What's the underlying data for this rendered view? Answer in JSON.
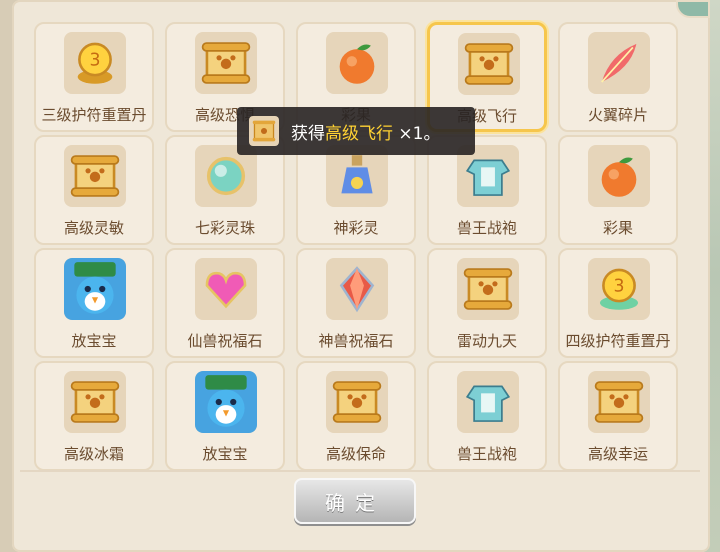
{
  "items": [
    {
      "name": "三级护符重置丹",
      "icon": "talisman-gold-icon"
    },
    {
      "name": "高级恐惧",
      "icon": "scroll-icon"
    },
    {
      "name": "彩果",
      "icon": "fruit-icon"
    },
    {
      "name": "高级飞行",
      "icon": "scroll-icon",
      "selected": true
    },
    {
      "name": "火翼碎片",
      "icon": "feather-icon"
    },
    {
      "name": "高级灵敏",
      "icon": "scroll-icon"
    },
    {
      "name": "七彩灵珠",
      "icon": "orb-icon"
    },
    {
      "name": "神彩灵",
      "icon": "potion-icon"
    },
    {
      "name": "兽王战袍",
      "icon": "armor-icon"
    },
    {
      "name": "彩果",
      "icon": "fruit-icon"
    },
    {
      "name": "放宝宝",
      "icon": "penguin-icon"
    },
    {
      "name": "仙兽祝福石",
      "icon": "heart-gem-icon"
    },
    {
      "name": "神兽祝福石",
      "icon": "crystal-icon"
    },
    {
      "name": "雷动九天",
      "icon": "scroll-icon"
    },
    {
      "name": "四级护符重置丹",
      "icon": "talisman-jade-icon"
    },
    {
      "name": "高级冰霜",
      "icon": "scroll-icon"
    },
    {
      "name": "放宝宝",
      "icon": "penguin-icon"
    },
    {
      "name": "高级保命",
      "icon": "scroll-icon"
    },
    {
      "name": "兽王战袍",
      "icon": "armor-icon"
    },
    {
      "name": "高级幸运",
      "icon": "scroll-icon"
    }
  ],
  "toast": {
    "prefix": "获得",
    "item": "高级飞行",
    "suffix": "×1。",
    "icon": "scroll-icon"
  },
  "confirm_label": "确定",
  "colors": {
    "highlight": "#ffd233",
    "selected_border": "#f6c64c",
    "text": "#6b4c2f"
  }
}
